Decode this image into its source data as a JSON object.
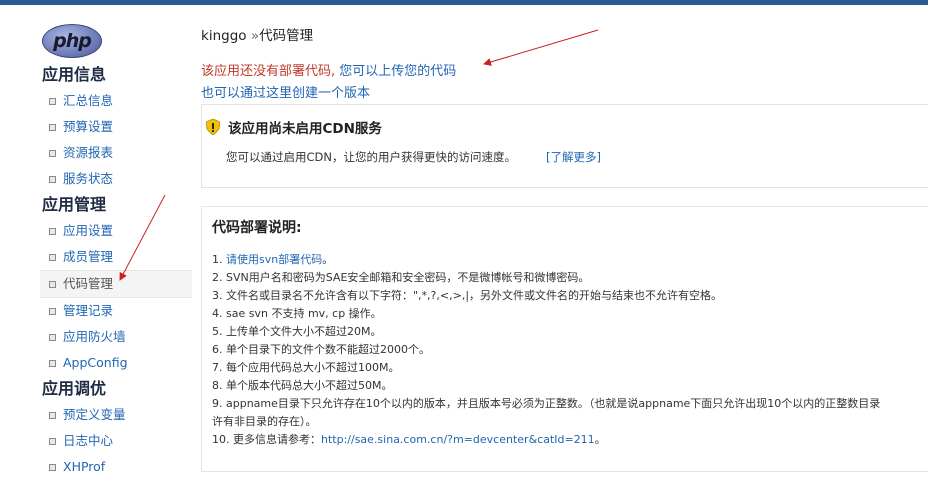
{
  "logo": {
    "text": "php"
  },
  "breadcrumb": {
    "app": "kinggo",
    "sep": " »",
    "page": "代码管理"
  },
  "sidebar": {
    "sections": [
      {
        "title": "应用信息",
        "items": [
          "汇总信息",
          "预算设置",
          "资源报表",
          "服务状态"
        ]
      },
      {
        "title": "应用管理",
        "items": [
          "应用设置",
          "成员管理",
          "代码管理",
          "管理记录",
          "应用防火墙",
          "AppConfig"
        ]
      },
      {
        "title": "应用调优",
        "items": [
          "预定义变量",
          "日志中心",
          "XHProf"
        ]
      }
    ],
    "active_item": "代码管理"
  },
  "warning": {
    "text": "该应用还没有部署代码, ",
    "link": "您可以上传您的代码"
  },
  "create_version": {
    "text": "也可以通过这里创建一个版本"
  },
  "cdn": {
    "title": "该应用尚未启用CDN服务",
    "text": "您可以通过启用CDN，让您的用户获得更快的访问速度。",
    "link": "[了解更多]"
  },
  "deploy": {
    "title": "代码部署说明:",
    "rules": [
      {
        "num": "1. ",
        "link": "请使用svn部署代码",
        "text": "。"
      },
      {
        "num": "2. ",
        "text": "SVN用户名和密码为SAE安全邮箱和安全密码，不是微博帐号和微博密码。"
      },
      {
        "num": "3. ",
        "text": "文件名或目录名不允许含有以下字符：\",*,?,<,>,|，另外文件或文件名的开始与结束也不允许有空格。"
      },
      {
        "num": "4. ",
        "text": "sae svn 不支持 mv, cp 操作。"
      },
      {
        "num": "5. ",
        "text": "上传单个文件大小不超过20M。"
      },
      {
        "num": "6. ",
        "text": "单个目录下的文件个数不能超过2000个。"
      },
      {
        "num": "7. ",
        "text": "每个应用代码总大小不超过100M。"
      },
      {
        "num": "8. ",
        "text": "单个版本代码总大小不超过50M。"
      },
      {
        "num": "9. ",
        "text": "appname目录下只允许存在10个以内的版本，并且版本号必须为正整数。（也就是说appname下面只允许出现10个以内的正整数目录"
      },
      {
        "num": "",
        "text": "许有非目录的存在）。"
      },
      {
        "num": "10. ",
        "text": "更多信息请参考：",
        "link": "http://sae.sina.com.cn/?m=devcenter&catId=211",
        "suffix": "。"
      }
    ]
  }
}
